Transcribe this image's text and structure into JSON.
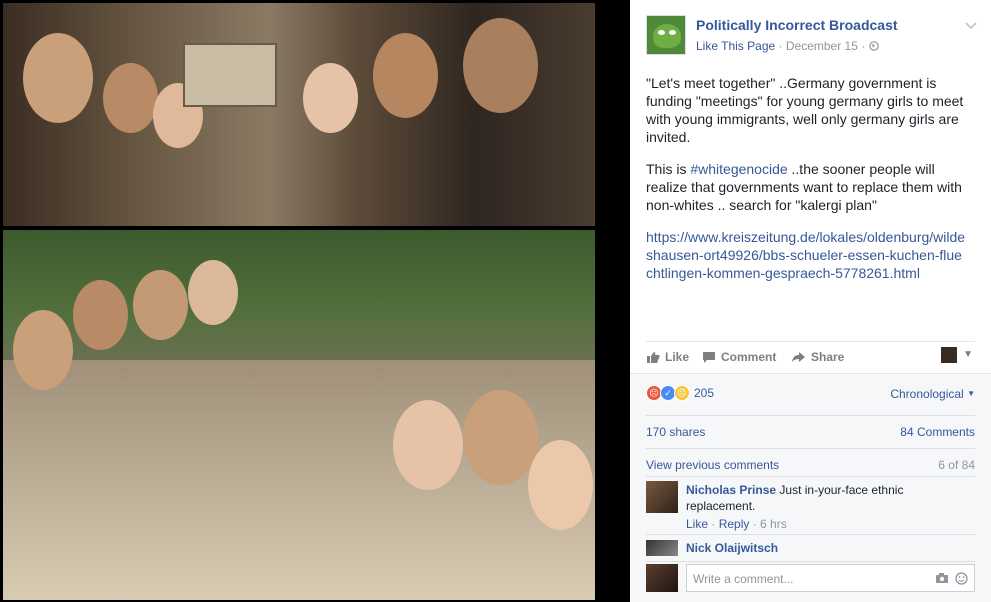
{
  "post": {
    "page_name": "Politically Incorrect Broadcast",
    "like_page": "Like This Page",
    "date": "December 15",
    "separator": "·",
    "paragraph1": "\"Let's meet together\" ..Germany government is funding \"meetings\" for young germany girls to meet with young immigrants, well only germany girls are invited.",
    "p2_before": "This is ",
    "p2_hashtag": "#whitegenocide",
    "p2_after": " ..the sooner people will realize that governments want to replace them with non-whites .. search for \"kalergi plan\"",
    "link": "https://www.kreiszeitung.de/lokales/oldenburg/wildeshausen-ort49926/bbs-schueler-essen-kuchen-fluechtlingen-kommen-gespraech-5778261.html"
  },
  "actions": {
    "like": "Like",
    "comment": "Comment",
    "share": "Share"
  },
  "reactions": {
    "count": "205",
    "sort": "Chronological",
    "icons": [
      "angry-icon",
      "like-icon",
      "sad-icon"
    ]
  },
  "stats": {
    "shares": "170 shares",
    "comments": "84 Comments"
  },
  "comments_nav": {
    "view_previous": "View previous comments",
    "position": "6 of 84"
  },
  "comments": [
    {
      "name": "Nicholas Prinse",
      "text": "Just in-your-face ethnic replacement.",
      "like": "Like",
      "reply": "Reply",
      "time": "6 hrs"
    },
    {
      "name": "Nick Olaijwitsch"
    }
  ],
  "composer": {
    "placeholder": "Write a comment..."
  },
  "colors": {
    "link": "#365899",
    "muted": "#90949c",
    "text": "#1d2129"
  }
}
